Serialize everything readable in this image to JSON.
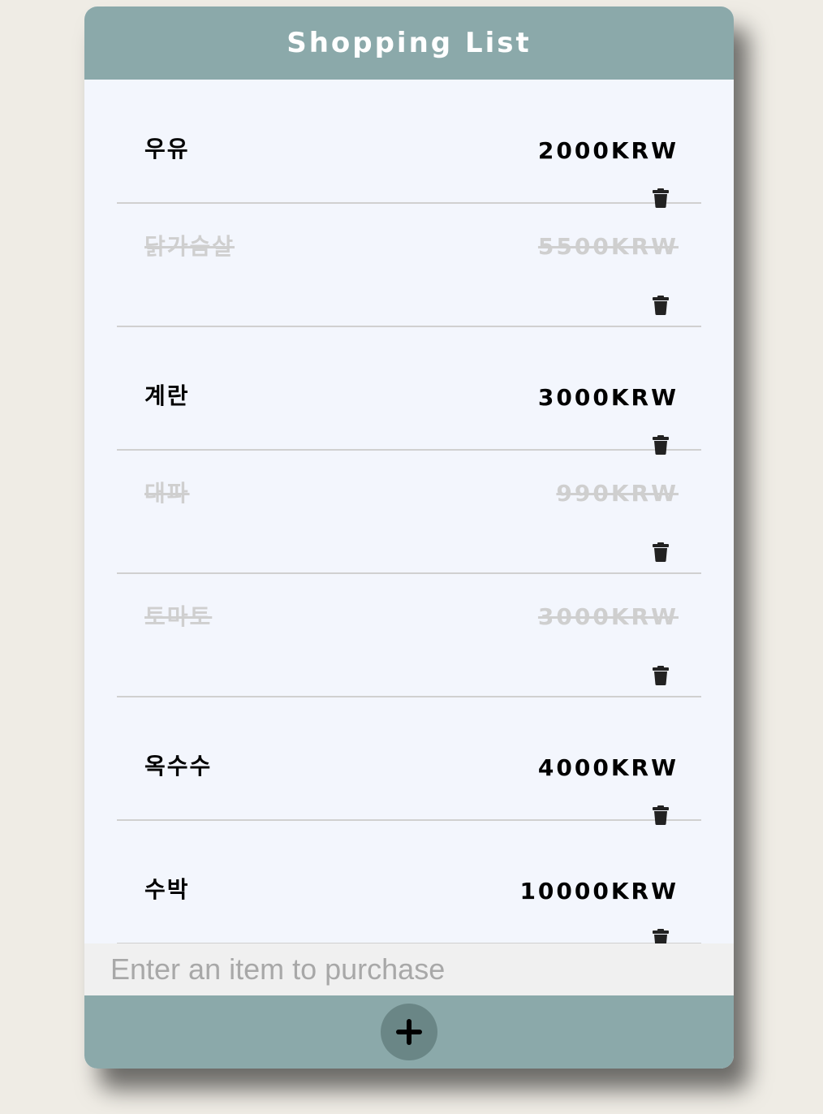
{
  "header": {
    "title": "Shopping List"
  },
  "items": [
    {
      "name": "우유",
      "price": "2000KRW",
      "done": false
    },
    {
      "name": "닭가슴살",
      "price": "5500KRW",
      "done": true
    },
    {
      "name": "계란",
      "price": "3000KRW",
      "done": false
    },
    {
      "name": "대파",
      "price": "990KRW",
      "done": true
    },
    {
      "name": "토마토",
      "price": "3000KRW",
      "done": true
    },
    {
      "name": "옥수수",
      "price": "4000KRW",
      "done": false
    },
    {
      "name": "수박",
      "price": "10000KRW",
      "done": false
    }
  ],
  "input": {
    "placeholder": "Enter an item to purchase",
    "value": ""
  },
  "colors": {
    "header_bg": "#8ba9aa",
    "list_bg": "#f3f6fd",
    "done_text": "#cfcfcf",
    "add_button_bg": "#6a8686"
  },
  "icons": {
    "delete": "trash-icon",
    "add": "plus-icon"
  }
}
